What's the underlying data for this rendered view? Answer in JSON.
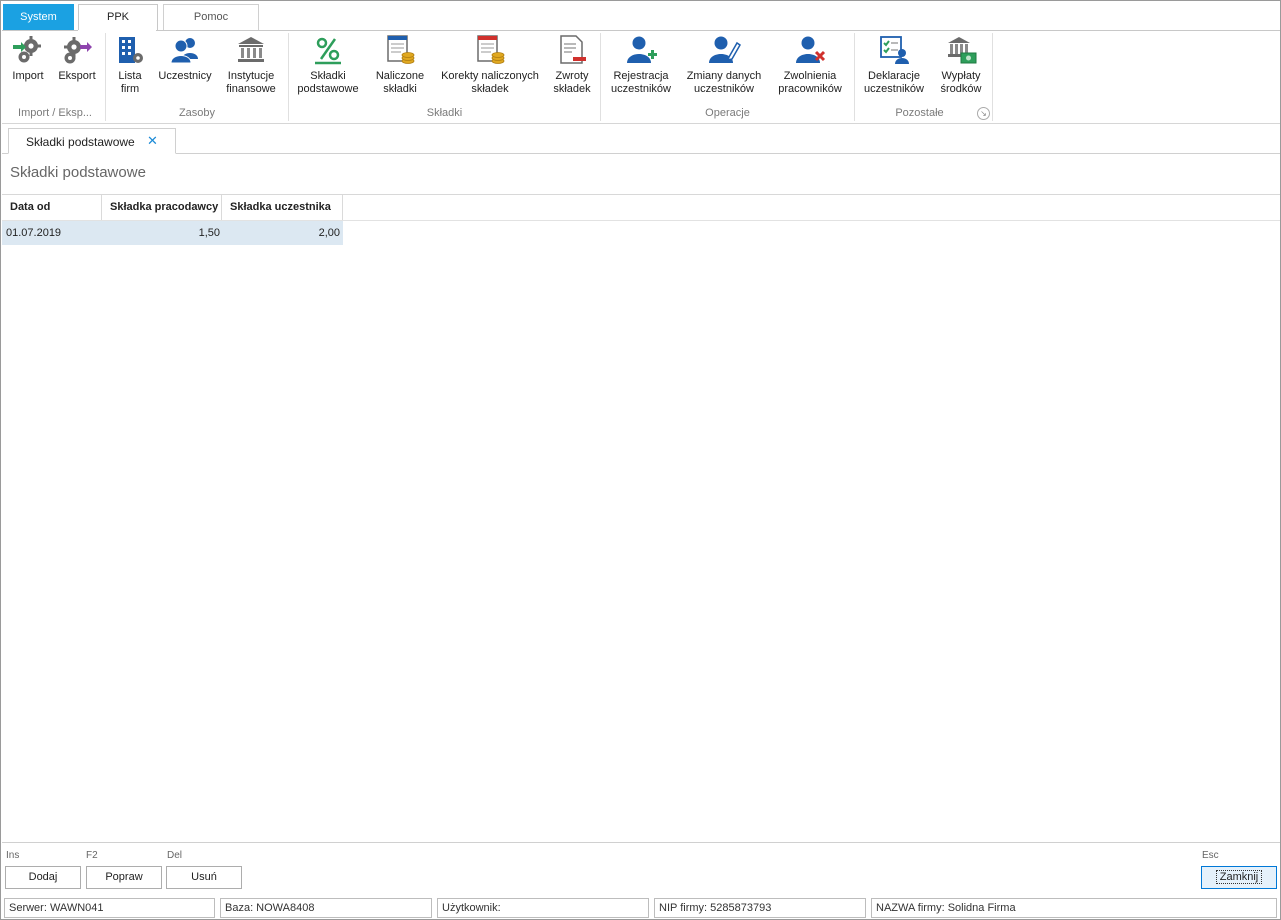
{
  "tabs": {
    "system": "System",
    "ppk": "PPK",
    "pomoc": "Pomoc"
  },
  "ribbon": {
    "buttons": {
      "import": "Import",
      "eksport": "Eksport",
      "lista_firm": [
        "Lista",
        "firm"
      ],
      "uczestnicy": "Uczestnicy",
      "instytucje": [
        "Instytucje",
        "finansowe"
      ],
      "skladki_podstawowe": [
        "Składki",
        "podstawowe"
      ],
      "naliczone": [
        "Naliczone",
        "składki"
      ],
      "korekty": [
        "Korekty naliczonych",
        "składek"
      ],
      "zwroty": [
        "Zwroty",
        "składek"
      ],
      "rejestracja": [
        "Rejestracja",
        "uczestników"
      ],
      "zmiany": [
        "Zmiany danych",
        "uczestników"
      ],
      "zwolnienia": [
        "Zwolnienia",
        "pracowników"
      ],
      "deklaracje": [
        "Deklaracje",
        "uczestników"
      ],
      "wyplaty": [
        "Wypłaty",
        "środków"
      ]
    },
    "groups": {
      "import_eksport": "Import / Eksp...",
      "zasoby": "Zasoby",
      "skladki": "Składki",
      "operacje": "Operacje",
      "pozostale": "Pozostałe"
    },
    "colors": {
      "accent": "#1ba1e2",
      "icon_blue": "#1f5fae",
      "icon_green": "#2e9e5b",
      "icon_red": "#d0312d"
    }
  },
  "document_tab": {
    "label": "Składki podstawowe",
    "close": "✕"
  },
  "page": {
    "title": "Składki podstawowe"
  },
  "grid": {
    "columns": [
      "Data od",
      "Składka pracodawcy",
      "Składka uczestnika"
    ],
    "rows": [
      [
        "01.07.2019",
        "1,50",
        "2,00"
      ]
    ]
  },
  "footer": {
    "hints": {
      "ins": "Ins",
      "f2": "F2",
      "del": "Del",
      "esc": "Esc"
    },
    "buttons": {
      "dodaj": "Dodaj",
      "popraw": "Popraw",
      "usun": "Usuń",
      "zamknij": "Zamknij"
    }
  },
  "statusbar": {
    "serwer": "Serwer: WAWN041",
    "baza": "Baza: NOWA8408",
    "uzytkownik": "Użytkownik:",
    "nip": "NIP firmy: 5285873793",
    "nazwa": "NAZWA firmy: Solidna Firma"
  }
}
